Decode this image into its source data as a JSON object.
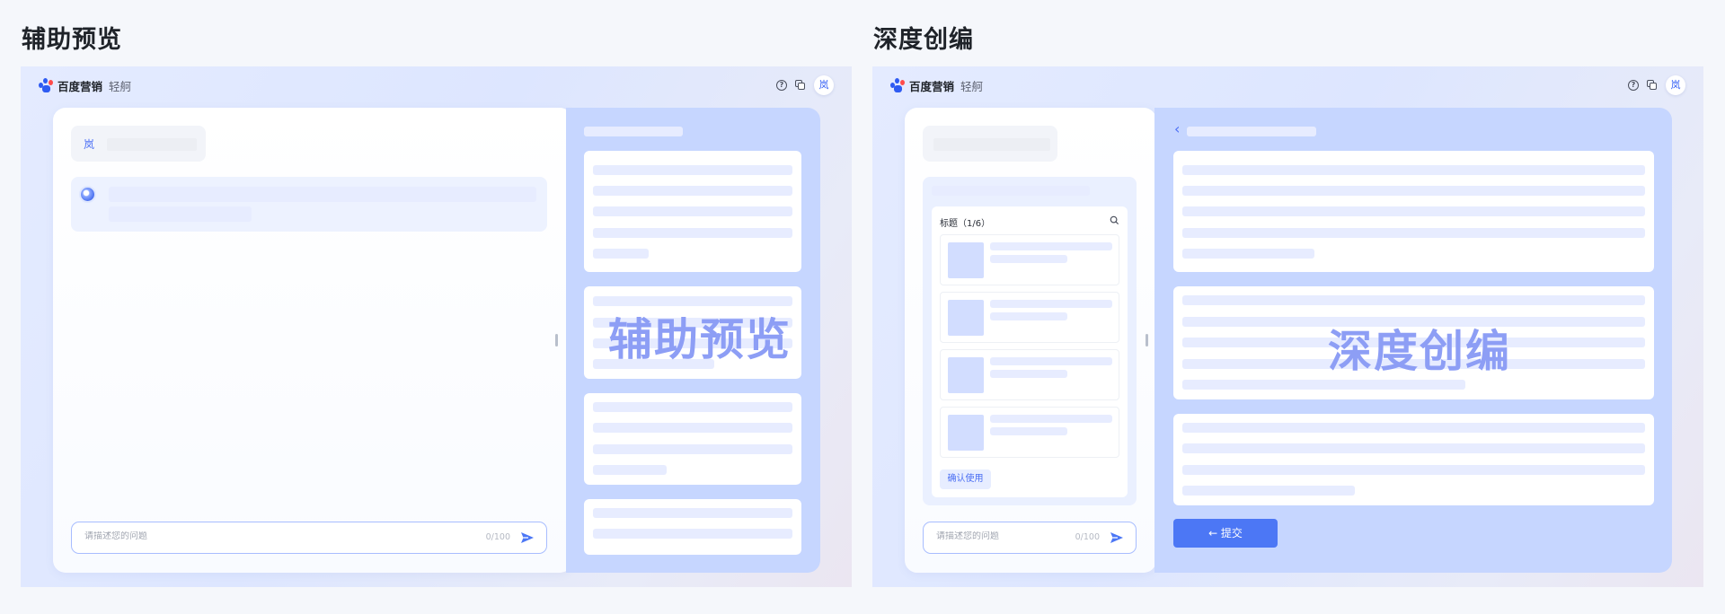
{
  "left": {
    "title": "辅助预览",
    "app": {
      "logo_text": "百度营销",
      "logo_sub": "轻舸",
      "avatar_char": "岚",
      "help_glyph": "?"
    },
    "chat": {
      "user_char": "岚",
      "input_placeholder": "请描述您的问题",
      "input_counter": "0/100"
    },
    "watermark": "辅助预览"
  },
  "right": {
    "title": "深度创编",
    "app": {
      "logo_text": "百度营销",
      "logo_sub": "轻舸",
      "avatar_char": "岚",
      "help_glyph": "?"
    },
    "chat": {
      "list_title": "标题（1/6）",
      "confirm_label": "确认使用",
      "input_placeholder": "请描述您的问题",
      "input_counter": "0/100"
    },
    "editor": {
      "back_glyph": "‹",
      "submit_label": "← 提交"
    },
    "watermark": "深度创编"
  },
  "colors": {
    "accent": "#4c77f5",
    "placeholder_bar": "#e7ecff",
    "watermark": "#8d9ef5",
    "panel_blue": "#c6d6ff"
  },
  "icons": [
    "baidu-paw-icon",
    "help-icon",
    "copy-icon",
    "send-icon",
    "search-icon",
    "back-icon",
    "arrow-left-icon"
  ]
}
